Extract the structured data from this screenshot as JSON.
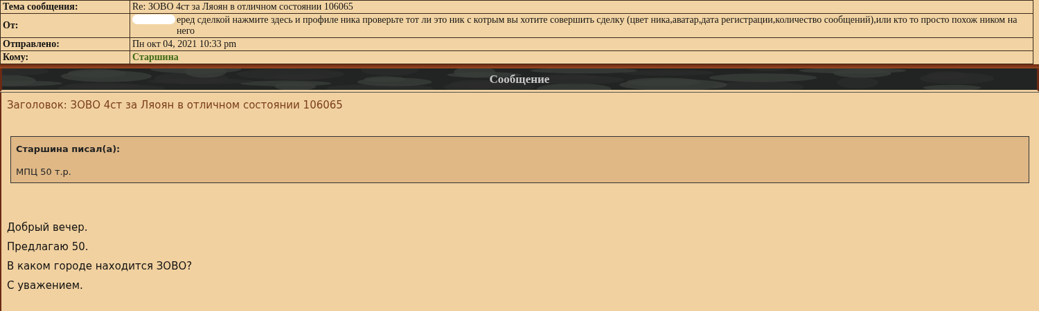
{
  "header_rows": [
    {
      "label": "Тема сообщения:",
      "value": "Re: ЗОВО 4ст за Ляоян в отличном состоянии 106065",
      "kind": "text",
      "redacted": false
    },
    {
      "label": "От:",
      "value": "еред сделкой нажмите здесь и профиле ника проверьте тот ли это ник с котрым вы хотите совершить сделку (цвет ника,аватар,дата регистрации,количество сообщений),или кто то просто похож ником на него",
      "kind": "text",
      "redacted": true
    },
    {
      "label": "Отправлено:",
      "value": "Пн окт 04, 2021 10:33 pm",
      "kind": "text",
      "redacted": false
    },
    {
      "label": "Кому:",
      "value": "Старшина",
      "kind": "user",
      "redacted": false
    }
  ],
  "section_title": "Сообщение",
  "message": {
    "subject": "Заголовок: ЗОВО 4ст за Ляоян в отличном состоянии 106065",
    "quote": {
      "author": "Старшина писал(а):",
      "text": "МПЦ 50 т.р."
    },
    "lines": [
      "Добрый вечер.",
      "Предлагаю 50.",
      "В каком городе находится ЗОВО?",
      "С уважением."
    ]
  }
}
